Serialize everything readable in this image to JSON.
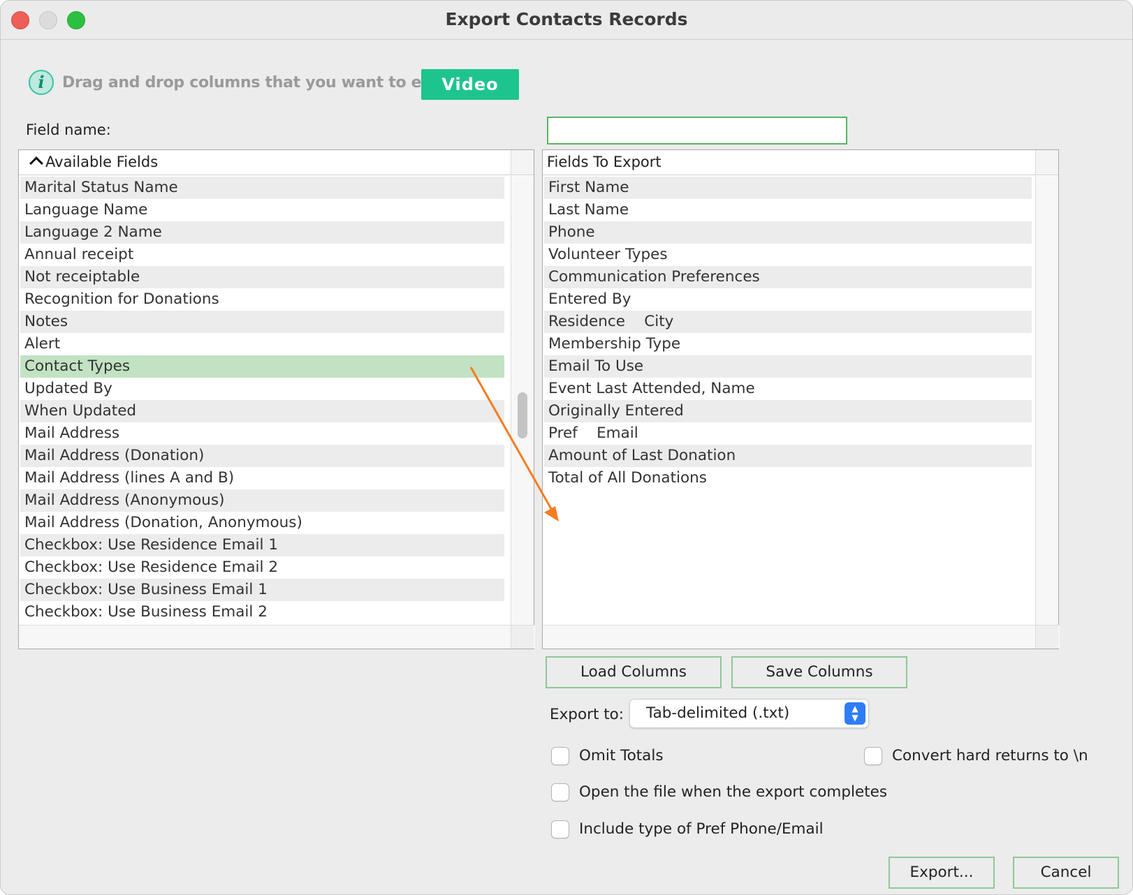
{
  "window": {
    "title": "Export Contacts Records"
  },
  "info": {
    "hint": "Drag and drop columns that you want to export",
    "video_label": "Video",
    "icon": "info-icon"
  },
  "field_name": {
    "label": "Field name:",
    "value": ""
  },
  "available": {
    "header": "Available Fields",
    "items": [
      "Marital Status Name",
      "Language Name",
      "Language 2 Name",
      "Annual receipt",
      "Not receiptable",
      "Recognition for Donations",
      "Notes",
      "Alert",
      "Contact Types",
      "Updated By",
      "When Updated",
      "Mail Address",
      "Mail Address (Donation)",
      "Mail Address (lines A and B)",
      "Mail Address (Anonymous)",
      "Mail Address (Donation, Anonymous)",
      "Checkbox: Use Residence Email 1",
      "Checkbox: Use Residence Email 2",
      "Checkbox: Use Business Email 1",
      "Checkbox: Use Business Email 2"
    ],
    "selected": "Contact Types"
  },
  "to_export": {
    "header": "Fields To Export",
    "items": [
      "First Name",
      "Last Name",
      "Phone",
      "Volunteer Types",
      "Communication Preferences",
      "Entered By",
      "Residence    City",
      "Membership Type",
      "Email To Use",
      "Event Last Attended, Name",
      "Originally Entered",
      "Pref    Email",
      "Amount of Last Donation",
      "Total of All Donations"
    ]
  },
  "buttons": {
    "load": "Load Columns",
    "save": "Save Columns",
    "export": "Export...",
    "cancel": "Cancel"
  },
  "export_to": {
    "label": "Export to:",
    "value": "Tab-delimited (.txt)"
  },
  "options": {
    "omit_totals": "Omit Totals",
    "convert_returns": "Convert hard returns to \\n",
    "open_file": "Open the file when the export completes",
    "include_type": "Include type of Pref Phone/Email"
  },
  "colors": {
    "accent": "#1ec48e",
    "selection": "#c2e3c3",
    "button_border": "#8fc896",
    "annotation_arrow": "#f57c1f"
  }
}
